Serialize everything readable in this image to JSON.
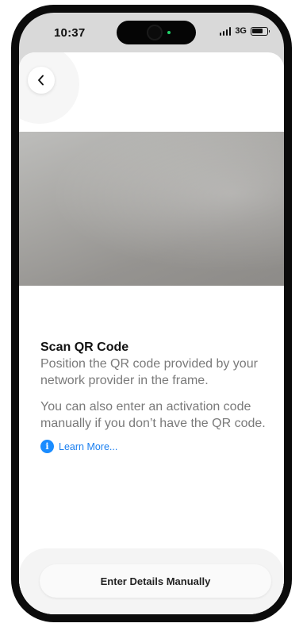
{
  "status_bar": {
    "time": "10:37",
    "network": "3G",
    "icons": [
      "signal-icon",
      "battery-icon"
    ]
  },
  "nav": {
    "back_icon": "chevron-left-icon"
  },
  "scan": {
    "title": "Scan QR Code",
    "instruction": "Position the QR code provided by your network provider in the frame.",
    "alternative": "You can also enter an activation code manually if you don’t have the QR code.",
    "learn_more_label": "Learn More...",
    "learn_more_icon": "info-icon"
  },
  "actions": {
    "manual_entry_label": "Enter Details Manually"
  },
  "colors": {
    "accent": "#1a8cff",
    "link": "#1a7ff0",
    "status_dot": "#20d36a"
  }
}
